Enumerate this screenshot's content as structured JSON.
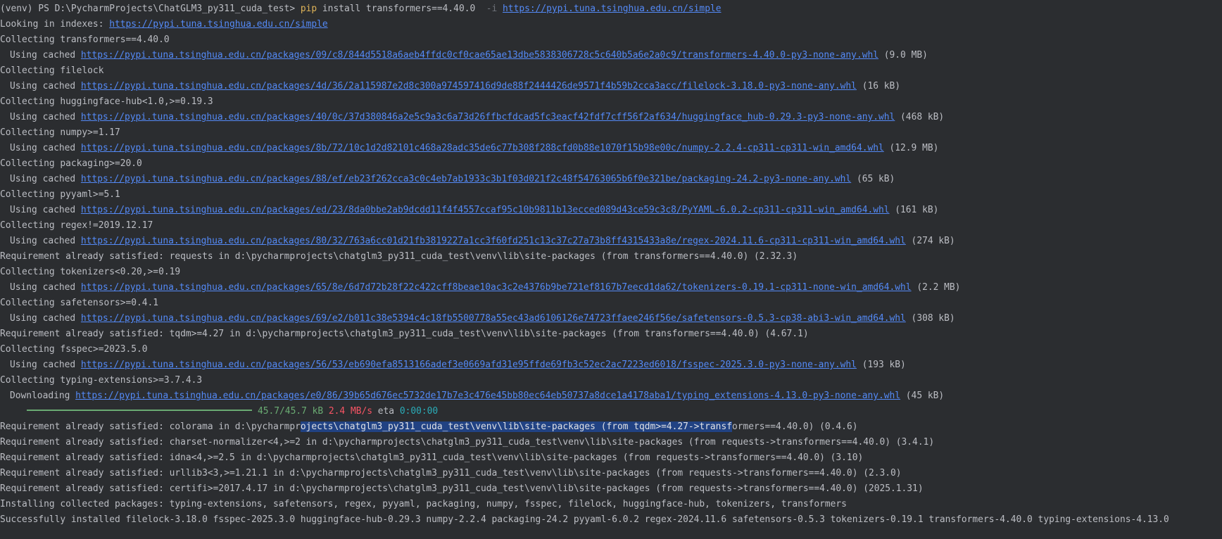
{
  "terminal": {
    "prompt": "(venv) PS D:\\PycharmProjects\\ChatGLM3_py311_cuda_test> ",
    "cmd_pip": "pip",
    "cmd_args": " install transformers==4.40.0  ",
    "cmd_flag": "-i",
    "cmd_space": " ",
    "cmd_url": "https://pypi.tuna.tsinghua.edu.cn/simple",
    "indexes_prefix": "Looking in indexes: ",
    "indexes_url": "https://pypi.tuna.tsinghua.edu.cn/simple",
    "using_cached_prefix": "Using cached ",
    "downloading_prefix": "Downloading ",
    "packages": [
      {
        "collect": "Collecting transformers==4.40.0",
        "url": "https://pypi.tuna.tsinghua.edu.cn/packages/09/c8/844d5518a6aeb4ffdc0cf0cae65ae13dbe5838306728c5c640b5a6e2a0c9/transformers-4.40.0-py3-none-any.whl",
        "size": " (9.0 MB)"
      },
      {
        "collect": "Collecting filelock",
        "url": "https://pypi.tuna.tsinghua.edu.cn/packages/4d/36/2a115987e2d8c300a974597416d9de88f2444426de9571f4b59b2cca3acc/filelock-3.18.0-py3-none-any.whl",
        "size": " (16 kB)"
      },
      {
        "collect": "Collecting huggingface-hub<1.0,>=0.19.3",
        "url": "https://pypi.tuna.tsinghua.edu.cn/packages/40/0c/37d380846a2e5c9a3c6a73d26ffbcfdcad5fc3eacf42fdf7cff56f2af634/huggingface_hub-0.29.3-py3-none-any.whl",
        "size": " (468 kB)"
      },
      {
        "collect": "Collecting numpy>=1.17",
        "url": "https://pypi.tuna.tsinghua.edu.cn/packages/8b/72/10c1d2d82101c468a28adc35de6c77b308f288cfd0b88e1070f15b98e00c/numpy-2.2.4-cp311-cp311-win_amd64.whl",
        "size": " (12.9 MB)"
      },
      {
        "collect": "Collecting packaging>=20.0",
        "url": "https://pypi.tuna.tsinghua.edu.cn/packages/88/ef/eb23f262cca3c0c4eb7ab1933c3b1f03d021f2c48f54763065b6f0e321be/packaging-24.2-py3-none-any.whl",
        "size": " (65 kB)"
      },
      {
        "collect": "Collecting pyyaml>=5.1",
        "url": "https://pypi.tuna.tsinghua.edu.cn/packages/ed/23/8da0bbe2ab9dcdd11f4f4557ccaf95c10b9811b13ecced089d43ce59c3c8/PyYAML-6.0.2-cp311-cp311-win_amd64.whl",
        "size": " (161 kB)"
      },
      {
        "collect": "Collecting regex!=2019.12.17",
        "url": "https://pypi.tuna.tsinghua.edu.cn/packages/80/32/763a6cc01d21fb3819227a1cc3f60fd251c13c37c27a73b8ff4315433a8e/regex-2024.11.6-cp311-cp311-win_amd64.whl",
        "size": " (274 kB)"
      }
    ],
    "req_requests": "Requirement already satisfied: requests in d:\\pycharmprojects\\chatglm3_py311_cuda_test\\venv\\lib\\site-packages (from transformers==4.40.0) (2.32.3)",
    "packages2": [
      {
        "collect": "Collecting tokenizers<0.20,>=0.19",
        "url": "https://pypi.tuna.tsinghua.edu.cn/packages/65/8e/6d7d72b28f22c422cff8beae10ac3c2e4376b9be721ef8167b7eecd1da62/tokenizers-0.19.1-cp311-none-win_amd64.whl",
        "size": " (2.2 MB)"
      },
      {
        "collect": "Collecting safetensors>=0.4.1",
        "url": "https://pypi.tuna.tsinghua.edu.cn/packages/69/e2/b011c38e5394c4c18fb5500778a55ec43ad6106126e74723ffaee246f56e/safetensors-0.5.3-cp38-abi3-win_amd64.whl",
        "size": " (308 kB)"
      }
    ],
    "req_tqdm": "Requirement already satisfied: tqdm>=4.27 in d:\\pycharmprojects\\chatglm3_py311_cuda_test\\venv\\lib\\site-packages (from transformers==4.40.0) (4.67.1)",
    "fsspec": {
      "collect": "Collecting fsspec>=2023.5.0",
      "url": "https://pypi.tuna.tsinghua.edu.cn/packages/56/53/eb690efa8513166adef3e0669afd31e95ffde69fb3c52ec2ac7223ed6018/fsspec-2025.3.0-py3-none-any.whl",
      "size": " (193 kB)"
    },
    "typing": {
      "collect": "Collecting typing-extensions>=3.7.4.3",
      "url": "https://pypi.tuna.tsinghua.edu.cn/packages/e0/86/39b65d676ec5732de17b7e3c476e45bb80ec64eb50737a8dce1a4178aba1/typing_extensions-4.13.0-py3-none-any.whl",
      "size": " (45 kB)"
    },
    "progress": {
      "size": "45.7/45.7 kB",
      "rate": " 2.4 MB/s",
      "eta_label": " eta ",
      "eta": "0:00:00",
      "fraction": 1.0
    },
    "colorama": {
      "pre": "Requirement already satisfied: colorama in d:\\pycharmpr",
      "selected": "ojects\\chatglm3_py311_cuda_test\\venv\\lib\\site-packages (from tqdm>=4.27->transf",
      "post": "ormers==4.40.0) (0.4.6)"
    },
    "req_lines": [
      "Requirement already satisfied: charset-normalizer<4,>=2 in d:\\pycharmprojects\\chatglm3_py311_cuda_test\\venv\\lib\\site-packages (from requests->transformers==4.40.0) (3.4.1)",
      "Requirement already satisfied: idna<4,>=2.5 in d:\\pycharmprojects\\chatglm3_py311_cuda_test\\venv\\lib\\site-packages (from requests->transformers==4.40.0) (3.10)",
      "Requirement already satisfied: urllib3<3,>=1.21.1 in d:\\pycharmprojects\\chatglm3_py311_cuda_test\\venv\\lib\\site-packages (from requests->transformers==4.40.0) (2.3.0)",
      "Requirement already satisfied: certifi>=2017.4.17 in d:\\pycharmprojects\\chatglm3_py311_cuda_test\\venv\\lib\\site-packages (from requests->transformers==4.40.0) (2025.1.31)",
      "Installing collected packages: typing-extensions, safetensors, regex, pyyaml, packaging, numpy, fsspec, filelock, huggingface-hub, tokenizers, transformers",
      "Successfully installed filelock-3.18.0 fsspec-2025.3.0 huggingface-hub-0.29.3 numpy-2.2.4 packaging-24.2 pyyaml-6.0.2 regex-2024.11.6 safetensors-0.5.3 tokenizers-0.19.1 transformers-4.40.0 typing-extensions-4.13.0"
    ],
    "colors": {
      "background": "#2b2d30",
      "text": "#bcbec4",
      "link": "#548af7",
      "pip": "#e0b458",
      "progress": "#6aab73",
      "rate": "#f75464",
      "eta": "#2aacb8",
      "selection": "#214283"
    }
  }
}
